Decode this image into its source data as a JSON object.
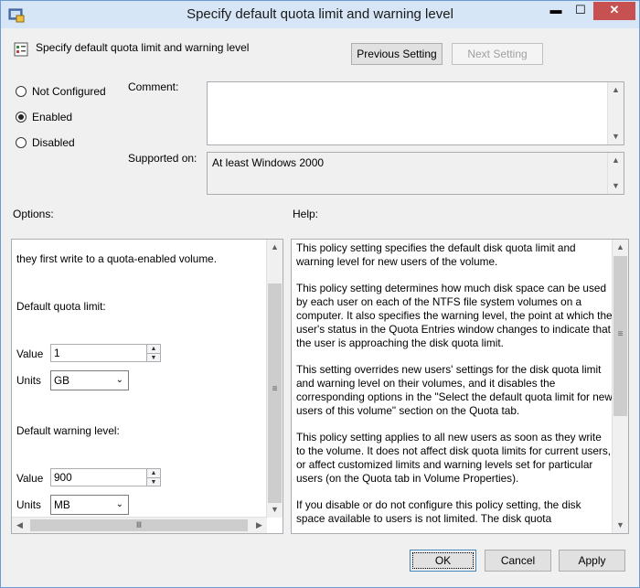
{
  "window": {
    "title": "Specify default quota limit and warning level"
  },
  "titlebar_buttons": {
    "minimize": "▬",
    "maximize": "☐",
    "close": "✕"
  },
  "header": {
    "policy_name": "Specify default quota limit and warning level",
    "previous_setting": "Previous Setting",
    "next_setting": "Next Setting"
  },
  "state": {
    "options": [
      {
        "label": "Not Configured",
        "selected": false
      },
      {
        "label": "Enabled",
        "selected": true
      },
      {
        "label": "Disabled",
        "selected": false
      }
    ]
  },
  "comment": {
    "label": "Comment:",
    "value": ""
  },
  "supported": {
    "label": "Supported on:",
    "value": "At least Windows 2000"
  },
  "options_panel": {
    "label": "Options:",
    "intro": "they first write to a quota-enabled volume.",
    "quota_limit": {
      "heading": "Default quota limit:",
      "value_label": "Value",
      "value": "1",
      "units_label": "Units",
      "units": "GB"
    },
    "warning_level": {
      "heading": "Default warning level:",
      "value_label": "Value",
      "value": "900",
      "units_label": "Units",
      "units": "MB"
    }
  },
  "help_panel": {
    "label": "Help:",
    "paragraphs": [
      "This policy setting specifies the default disk quota limit and warning level for new users of the volume.",
      "This policy setting determines how much disk space can be used by each user on each of the NTFS file system volumes on a computer. It also specifies the warning level, the point at which the user's status in the Quota Entries window changes to indicate that the user is approaching the disk quota limit.",
      "This setting overrides new users' settings for the disk quota limit and warning level on their volumes, and it disables the corresponding options in the \"Select the default quota limit for new users of this volume\" section on the Quota tab.",
      "This policy setting applies to all new users as soon as they write to the volume. It does not affect disk quota limits for current users, or affect customized limits and warning levels set for particular users (on the Quota tab in Volume Properties).",
      "If you disable or do not configure this policy setting, the disk space available to users is not limited. The disk quota"
    ]
  },
  "footer": {
    "ok": "OK",
    "cancel": "Cancel",
    "apply": "Apply"
  },
  "scroll_glyphs": {
    "up": "▲",
    "down": "▼",
    "left": "◀",
    "right": "▶",
    "grip_v": "≡",
    "grip_h": "Ⅲ",
    "dropdown": "⌄"
  }
}
